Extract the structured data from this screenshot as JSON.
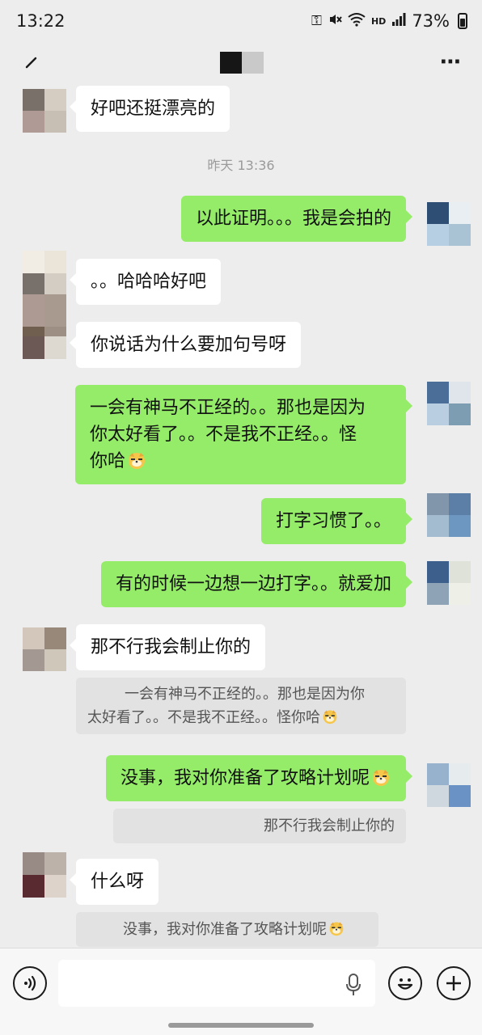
{
  "status_bar": {
    "time": "13:22",
    "network": "HD",
    "battery": "73%"
  },
  "header": {
    "title_colors": [
      "#161616",
      "#c9c9c9"
    ]
  },
  "chat": {
    "messages": [
      {
        "side": "in",
        "text": "好吧还挺漂亮的"
      },
      {
        "timestamp": "昨天 13:36"
      },
      {
        "side": "out",
        "text": "以此证明。。。我是会拍的"
      },
      {
        "side": "in",
        "text": "。。哈哈哈好吧"
      },
      {
        "side": "in",
        "text": "你说话为什么要加句号呀"
      },
      {
        "side": "out",
        "line1": "一会有神马不正经的。。那也是因为",
        "line2": "你太好看了。。不是我不正经。。怪",
        "line3": "你哈",
        "emoji": "doge-emoji"
      },
      {
        "side": "out",
        "text": "打字习惯了。。"
      },
      {
        "side": "out",
        "text": "有的时候一边想一边打字。。就爱加"
      },
      {
        "side": "in",
        "text": "那不行我会制止你的"
      },
      {
        "quote_line1": "一会有神马不正经的。。那也是因为你",
        "quote_line2": "太好看了。。不是我不正经。。怪你哈",
        "emoji": "doge-emoji"
      },
      {
        "side": "out",
        "text": "没事，我对你准备了攻略计划呢",
        "emoji": "doge-emoji"
      },
      {
        "quote": "那不行我会制止你的"
      },
      {
        "side": "in",
        "text": "什么呀"
      },
      {
        "quote": "没事，我对你准备了攻略计划呢",
        "emoji": "doge-emoji"
      }
    ]
  },
  "input_bar": {
    "placeholder": ""
  },
  "colors": {
    "background": "#ededed",
    "bubble_out": "#95ec69",
    "bubble_in": "#ffffff"
  }
}
